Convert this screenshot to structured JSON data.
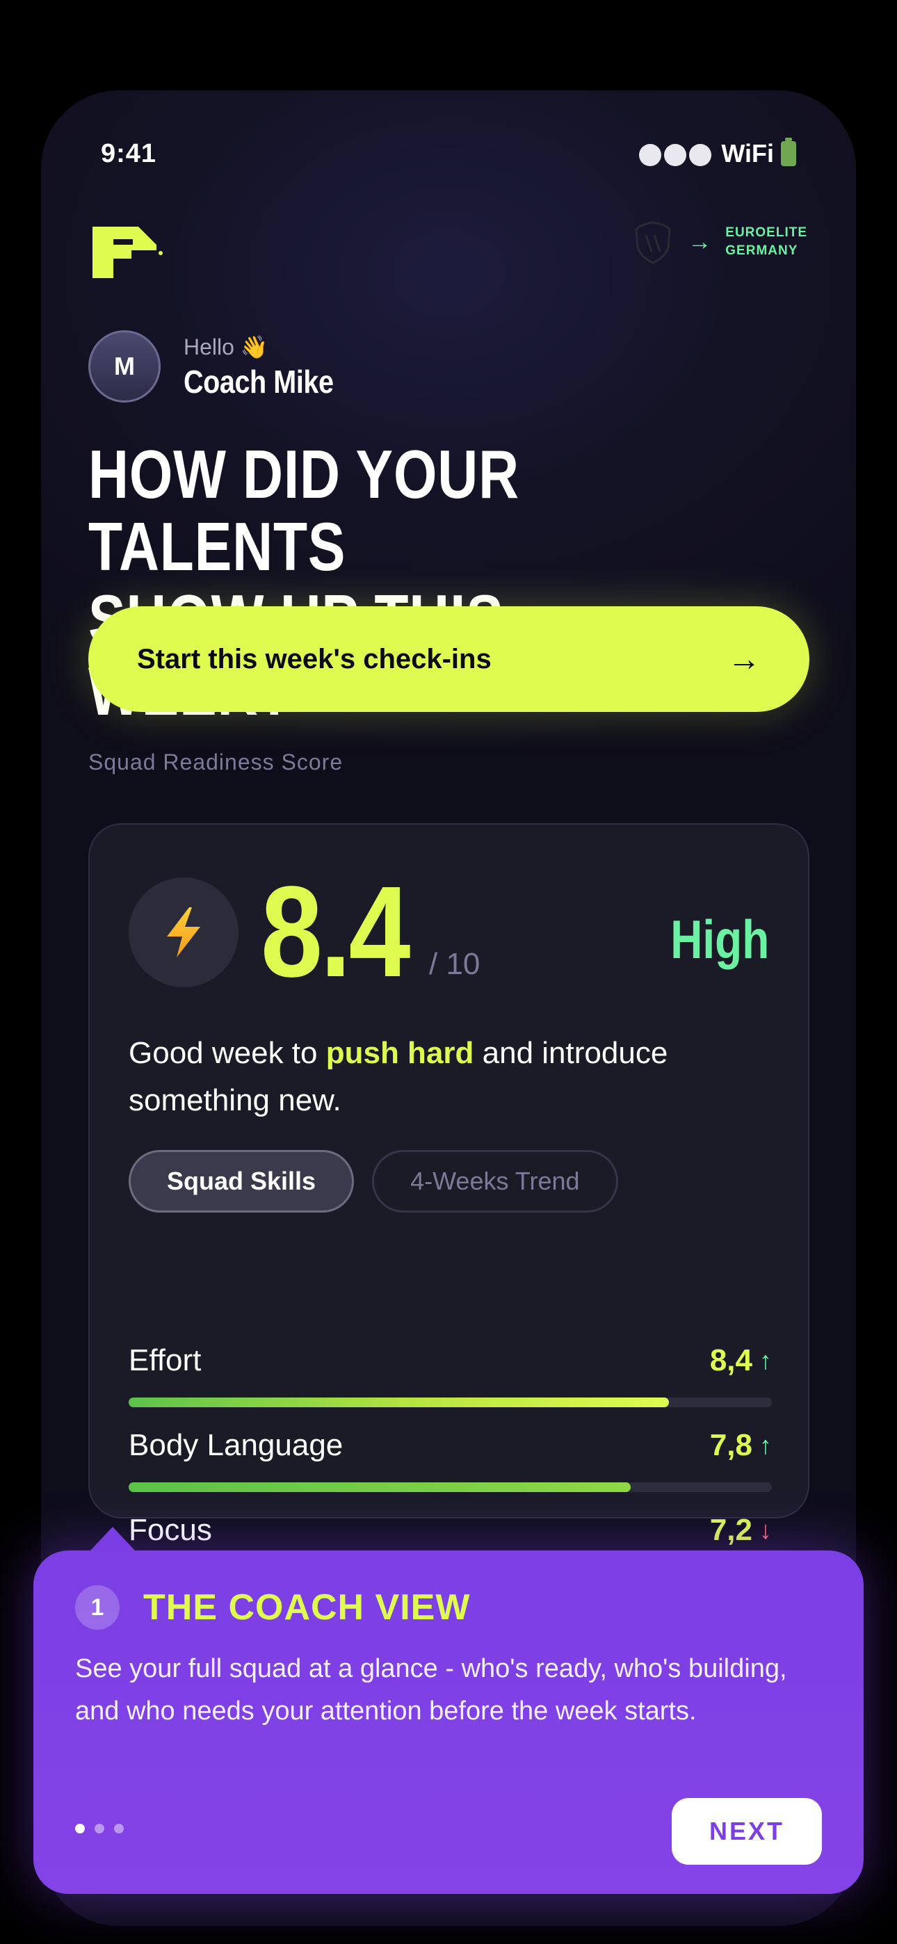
{
  "status_bar": {
    "time": "9:41",
    "network": "WiFi"
  },
  "club": {
    "name_line1": "EUROELITE",
    "name_line2": "GERMANY"
  },
  "greeting": {
    "hello": "Hello 👋",
    "name": "Coach Mike",
    "avatar_initial": "M"
  },
  "headline": {
    "line1": "HOW DID YOUR TALENTS",
    "line2": "SHOW UP THIS WEEK?"
  },
  "cta": {
    "label": "Start this week's check-ins",
    "arrow": "→"
  },
  "readiness": {
    "section_label": "Squad Readiness Score",
    "score": "8.4",
    "score_max": "/ 10",
    "level": "High",
    "desc_before": "Good week to ",
    "desc_highlight": "push hard",
    "desc_after": " and introduce something new.",
    "tabs": [
      {
        "label": "Squad Skills",
        "active": true
      },
      {
        "label": "4-Weeks Trend",
        "active": false
      }
    ],
    "metrics": [
      {
        "label": "Effort",
        "value": "8,4",
        "trend": "↑",
        "fill": 0.84
      },
      {
        "label": "Body Language",
        "value": "7,8",
        "trend": "↑",
        "fill": 0.78
      },
      {
        "label": "Focus",
        "value": "7,2",
        "trend": "↓",
        "fill": 0.72
      }
    ]
  },
  "tooltip": {
    "step": "1",
    "title": "THE COACH VIEW",
    "body": "See your full squad at a glance - who's ready, who's building, and who needs your attention before the week starts.",
    "next_label": "NEXT",
    "page": 1,
    "pages": 3
  },
  "colors": {
    "accent": "#dffb4f",
    "positive": "#6af2a2",
    "negative": "#ff6f7a",
    "tooltip": "#7b3fe4"
  },
  "icons": {
    "logo": "brand-f-logo",
    "crest": "club-crest",
    "bolt": "lightning-bolt"
  }
}
